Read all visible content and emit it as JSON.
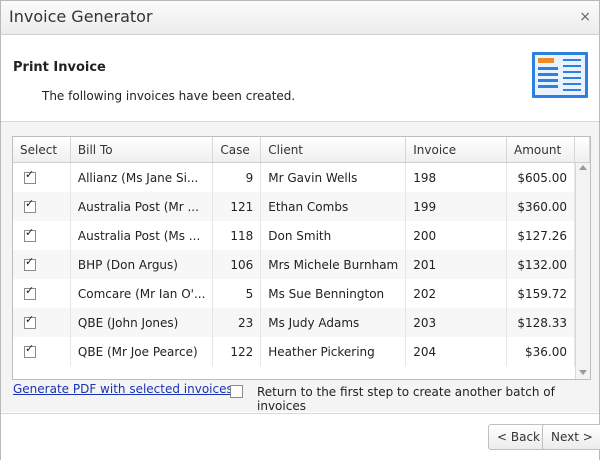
{
  "window": {
    "title": "Invoice Generator",
    "close_glyph": "×"
  },
  "header": {
    "title": "Print Invoice",
    "subtitle": "The following invoices have been created.",
    "icon": "invoice-document-icon"
  },
  "table": {
    "columns": [
      "Select",
      "Bill To",
      "Case",
      "Client",
      "Invoice",
      "Amount"
    ],
    "rows": [
      {
        "bill_to": "Allianz (Ms Jane Si...",
        "case": "9",
        "client": "Mr Gavin Wells",
        "invoice": "198",
        "amount": "$605.00",
        "checked": true
      },
      {
        "bill_to": "Australia Post (Mr ...",
        "case": "121",
        "client": "Ethan Combs",
        "invoice": "199",
        "amount": "$360.00",
        "checked": true
      },
      {
        "bill_to": "Australia Post (Ms ...",
        "case": "118",
        "client": "Don Smith",
        "invoice": "200",
        "amount": "$127.26",
        "checked": true
      },
      {
        "bill_to": "BHP (Don Argus)",
        "case": "106",
        "client": "Mrs Michele Burnham",
        "invoice": "201",
        "amount": "$132.00",
        "checked": true
      },
      {
        "bill_to": "Comcare (Mr Ian O'...",
        "case": "5",
        "client": "Ms Sue Bennington",
        "invoice": "202",
        "amount": "$159.72",
        "checked": true
      },
      {
        "bill_to": "QBE (John Jones)",
        "case": "23",
        "client": "Ms Judy Adams",
        "invoice": "203",
        "amount": "$128.33",
        "checked": true
      },
      {
        "bill_to": "QBE (Mr Joe Pearce)",
        "case": "122",
        "client": "Heather Pickering",
        "invoice": "204",
        "amount": "$36.00",
        "checked": true
      }
    ]
  },
  "actions": {
    "generate_link": "Generate PDF with selected invoices",
    "return_label": "Return to the first step to create another batch of invoices",
    "return_checked": false
  },
  "footer": {
    "back": "< Back",
    "next": "Next >"
  },
  "colors": {
    "link": "#1a33b8",
    "border": "#bdbdbd",
    "accent_icon": "#2f7fe0",
    "accent_bar": "#f08a24"
  }
}
